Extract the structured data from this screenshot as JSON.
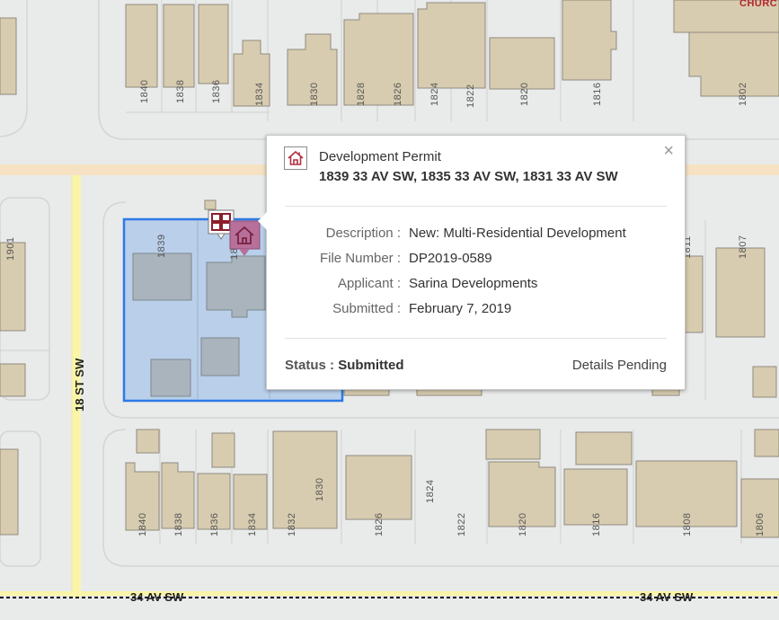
{
  "map": {
    "church_label": "CHURC",
    "streets": {
      "vertical": "18 ST SW",
      "bottom_left": "34 AV SW",
      "bottom_right": "34 AV SW"
    },
    "lots_top": [
      "1840",
      "1838",
      "1836",
      "1834",
      "1830",
      "1828",
      "1826",
      "1824",
      "1822",
      "1820",
      "1816",
      "1802"
    ],
    "lots_mid_left": [
      "1901",
      "1839",
      "18"
    ],
    "lots_mid_right": [
      "1811",
      "1807"
    ],
    "lots_bottom": [
      "1840",
      "1838",
      "1836",
      "1834",
      "1832",
      "1830",
      "1826",
      "1824",
      "1822",
      "1820",
      "1816",
      "1808",
      "1806"
    ]
  },
  "popup": {
    "title": "Development Permit",
    "address": "1839 33 AV SW, 1835 33 AV SW, 1831 33 AV SW",
    "close_symbol": "×",
    "fields": [
      {
        "label": "Description :",
        "value": "New: Multi-Residential Development"
      },
      {
        "label": "File Number :",
        "value": "DP2019-0589"
      },
      {
        "label": "Applicant :",
        "value": "Sarina Developments"
      },
      {
        "label": "Submitted :",
        "value": "February 7, 2019"
      }
    ],
    "status_label": "Status :",
    "status_value": "Submitted",
    "details_link": "Details Pending"
  },
  "icons": {
    "header": "house-icon",
    "marker_primary": "house-marker-icon",
    "marker_secondary": "multi-unit-marker-icon"
  },
  "colors": {
    "building": "#d8ccb0",
    "selection_fill": "#b9cfea",
    "selection_stroke": "#2d79e6",
    "road_major": "#f6e2c2",
    "road_vertical": "#faf5a8",
    "marker": "#b7709a"
  }
}
